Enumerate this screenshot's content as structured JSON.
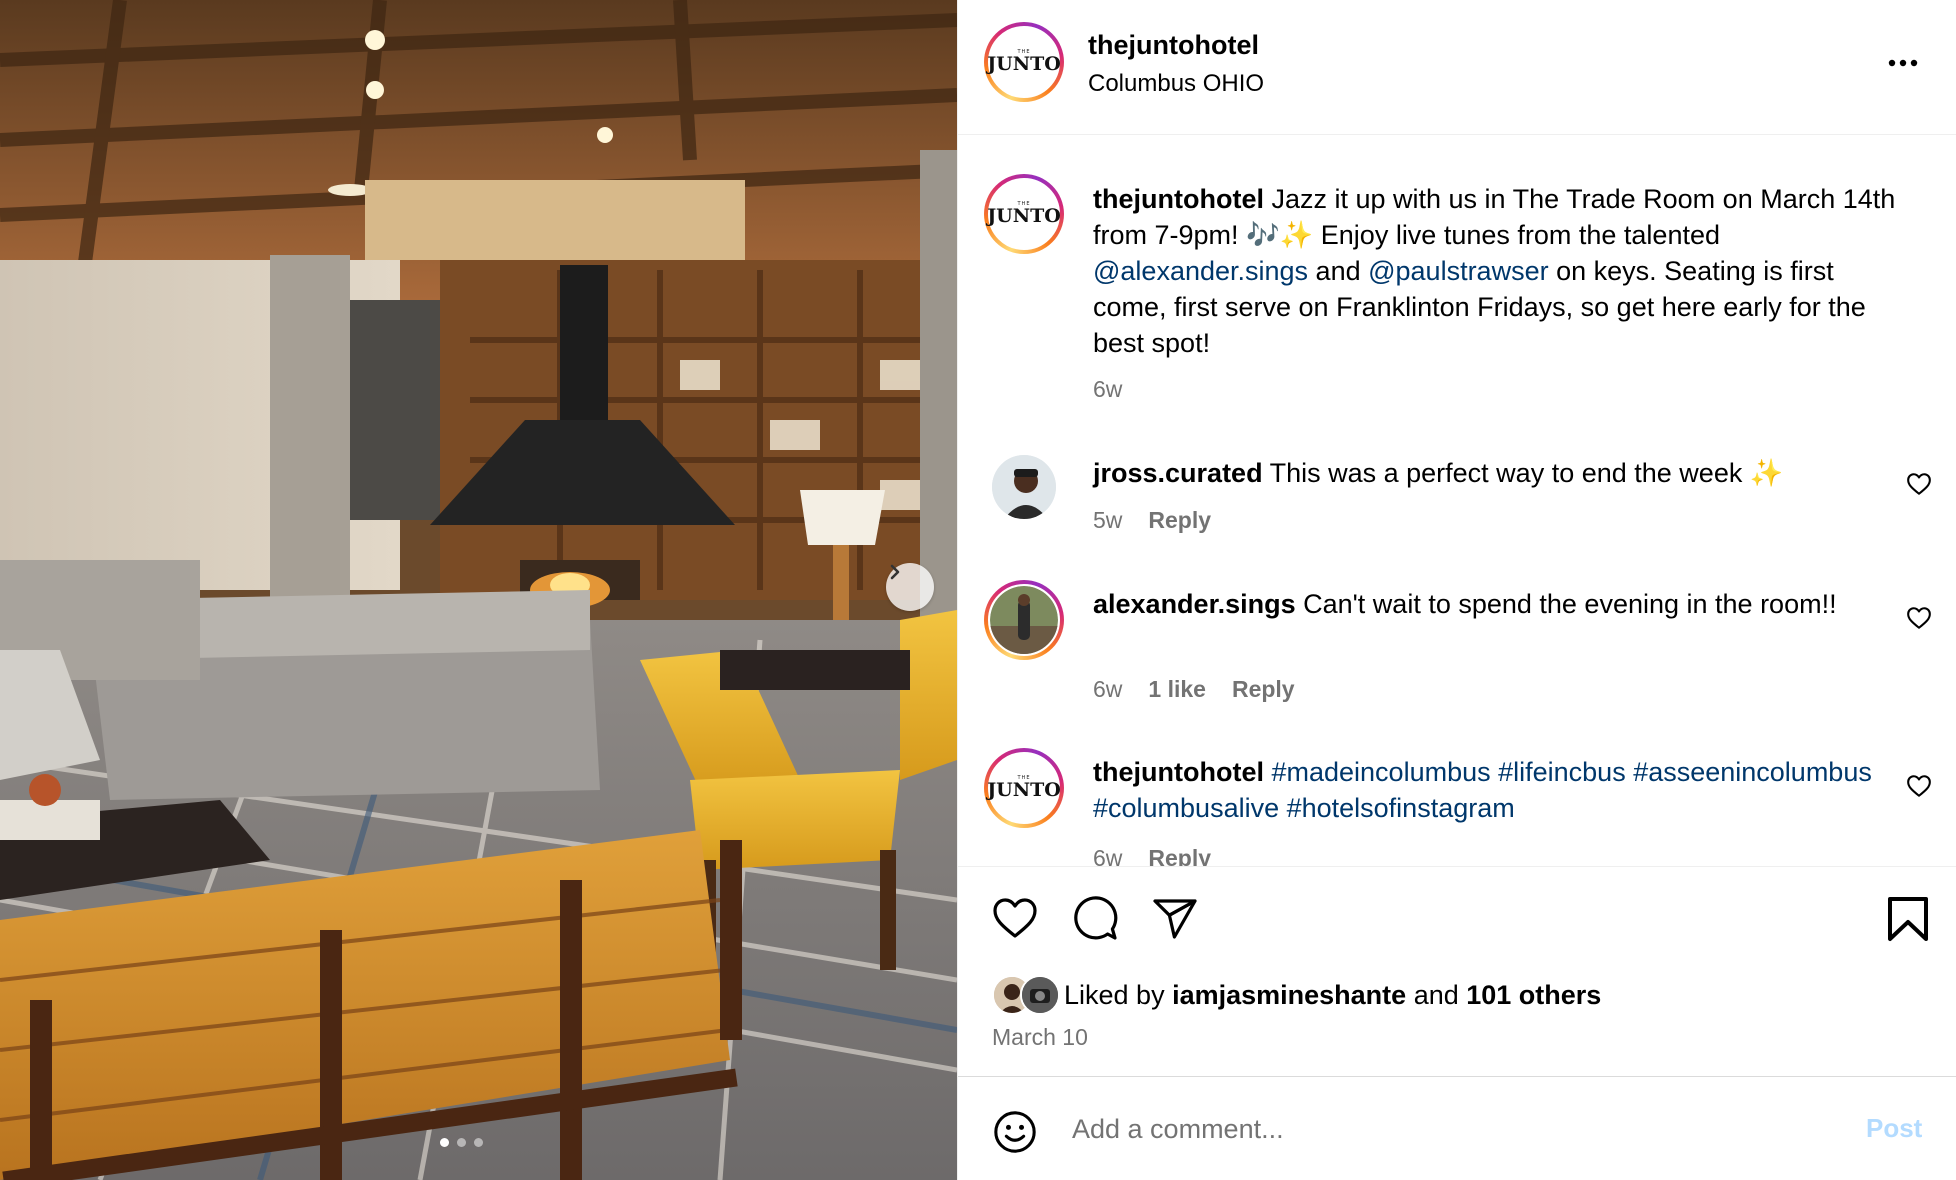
{
  "post": {
    "username": "thejuntohotel",
    "location": "Columbus OHIO",
    "logo_small": "THE",
    "logo_name": "JUNTO"
  },
  "caption": {
    "username": "thejuntohotel",
    "text_1": " Jazz it up with us in The Trade Room on March 14th from 7-9pm! 🎶✨ Enjoy live tunes from the talented ",
    "mention_1": "@alexander.sings",
    "text_2": " and ",
    "mention_2": "@paulstrawser",
    "text_3": " on keys. Seating is first come, first serve on Franklinton Fridays, so get here early for the best spot!",
    "time": "6w"
  },
  "comments": [
    {
      "username": "jross.curated",
      "text": " This was a perfect way to end the week ✨",
      "time": "5w",
      "likes": "",
      "reply": "Reply"
    },
    {
      "username": "alexander.sings",
      "text": " Can't wait to spend the evening in the room!!",
      "time": "6w",
      "likes": "1 like",
      "reply": "Reply"
    },
    {
      "username": "thejuntohotel",
      "hashtags": "#madeincolumbus #lifeincbus #asseenincolumbus #columbusalive #hotelsofinstagram",
      "time": "6w",
      "reply": "Reply"
    }
  ],
  "likes": {
    "prefix": "Liked by ",
    "user": "iamjasmineshante",
    "middle": " and ",
    "others": "101 others"
  },
  "date": "March 10",
  "add_comment": {
    "placeholder": "Add a comment...",
    "post_label": "Post"
  },
  "icons": [
    "more-icon",
    "heart-icon",
    "comment-icon",
    "share-icon",
    "bookmark-icon",
    "emoji-icon",
    "chevron-right-icon"
  ],
  "colors": {
    "mention": "#00376b",
    "muted": "#737373",
    "post_disabled": "#b3dbff"
  },
  "carousel": {
    "slides": 3,
    "active": 1
  }
}
